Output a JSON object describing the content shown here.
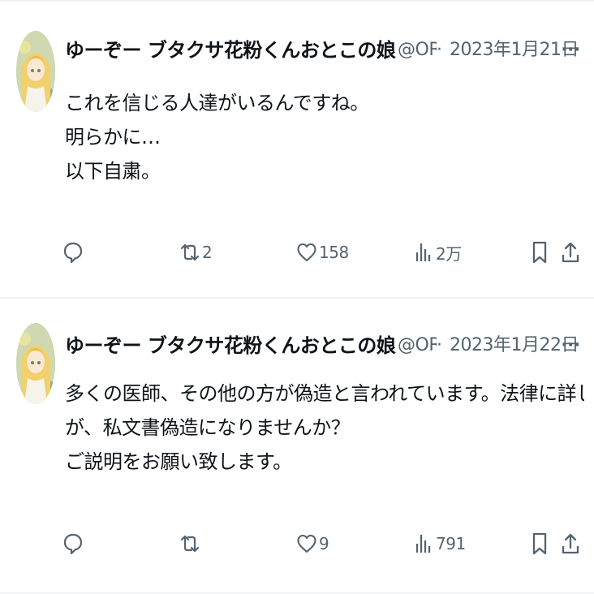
{
  "tweets": [
    {
      "display_name": "ゆーぞー ブタクサ花粉くんおとこの娘 マラみちの",
      "handle": "@ORS",
      "separator": "·",
      "date": "2023年1月21日",
      "more": "···",
      "lines": [
        "これを信じる人達がいるんですね。",
        "明らかに…",
        "以下自粛。"
      ],
      "stats": {
        "reply": "",
        "retweet": "2",
        "like": "158",
        "views": "2万"
      }
    },
    {
      "display_name": "ゆーぞー ブタクサ花粉くんおとこの娘 マラみちの",
      "handle": "@ORS",
      "separator": "·",
      "date": "2023年1月22日",
      "more": "···",
      "lines": [
        "多くの医師、その他の方が偽造と言われています。法律に詳しくありません",
        "が、私文書偽造になりませんか？",
        "ご説明をお願い致します。"
      ],
      "stats": {
        "reply": "",
        "retweet": "",
        "like": "9",
        "views": "791"
      }
    }
  ],
  "icons": {
    "reply": "reply-icon",
    "retweet": "retweet-icon",
    "like": "heart-icon",
    "views": "views-chart-icon",
    "bookmark": "bookmark-icon",
    "share": "share-icon"
  },
  "colors": {
    "text": "#0f1419",
    "secondary": "#536471",
    "divider": "#eff3f4"
  }
}
